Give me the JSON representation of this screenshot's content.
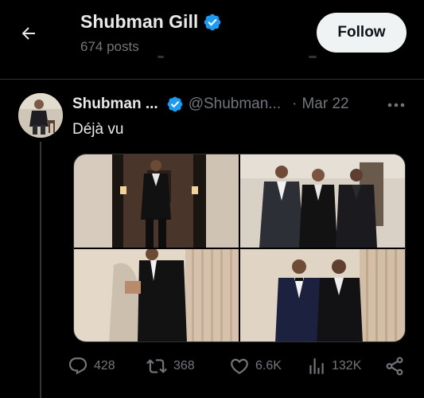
{
  "header": {
    "title": "Shubman Gill",
    "subtitle": "674 posts",
    "follow_label": "Follow",
    "back_icon": "arrow-left-icon",
    "verified_icon": "verified-badge-icon"
  },
  "tweet": {
    "author_name": "Shubman ...",
    "handle": "@Shubman...",
    "separator": "·",
    "date": "Mar 22",
    "text": "Déjà vu",
    "media_count": 4
  },
  "actions": {
    "replies": "428",
    "reposts": "368",
    "likes": "6.6K",
    "views": "132K",
    "icons": [
      "reply-icon",
      "repost-icon",
      "like-icon",
      "views-icon",
      "share-icon"
    ]
  },
  "colors": {
    "background": "#000000",
    "text_primary": "#e7e9ea",
    "text_secondary": "#71767b",
    "verified_blue": "#1d9bf0",
    "divider": "#2f3336",
    "follow_bg": "#eff3f4"
  }
}
